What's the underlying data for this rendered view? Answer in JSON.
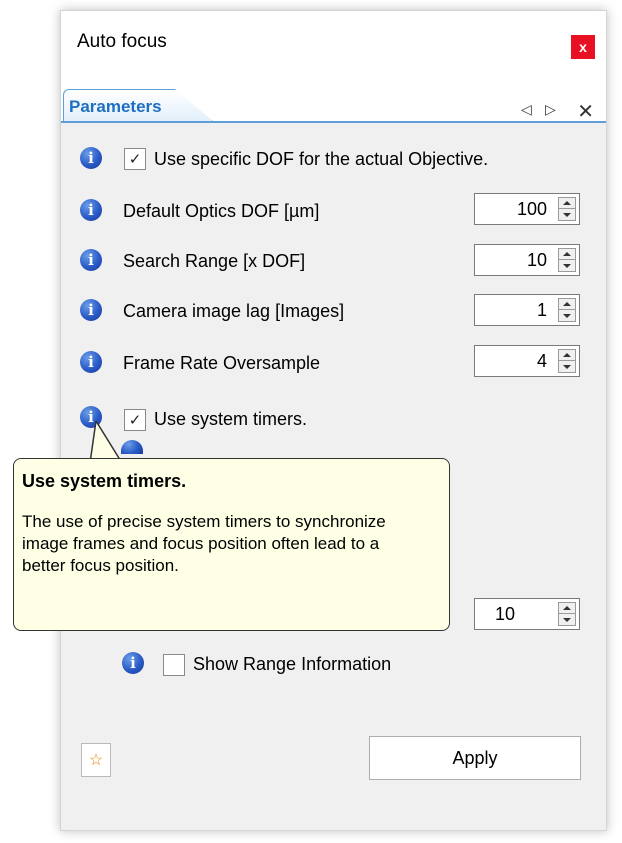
{
  "window": {
    "title": "Auto focus",
    "close_label": "x"
  },
  "tabs": {
    "active_label": "Parameters",
    "nav_prev": "◁",
    "nav_next": "▷",
    "close": "✕"
  },
  "params": [
    {
      "type": "checkbox",
      "label": "Use specific DOF for the actual Objective.",
      "checked": true,
      "check_mark": "✓"
    },
    {
      "type": "spin",
      "label": "Default Optics DOF [µm]",
      "value": "100"
    },
    {
      "type": "spin",
      "label": "Search Range [x DOF]",
      "value": "10"
    },
    {
      "type": "spin",
      "label": "Camera image lag [Images]",
      "value": "1"
    },
    {
      "type": "spin",
      "label": "Frame Rate Oversample",
      "value": "4"
    },
    {
      "type": "checkbox",
      "label": "Use system timers.",
      "checked": true,
      "check_mark": "✓"
    }
  ],
  "hidden_row": {
    "value": "10"
  },
  "range_info": {
    "label": "Show Range Information",
    "checked": false
  },
  "tooltip": {
    "title": "Use system timers.",
    "body": "The use of precise system timers to synchronize image frames and focus position often lead to a better focus position."
  },
  "footer": {
    "star_icon": "star-icon",
    "star_glyph": "☆",
    "apply_label": "Apply"
  },
  "icons": {
    "info_glyph": "i"
  }
}
